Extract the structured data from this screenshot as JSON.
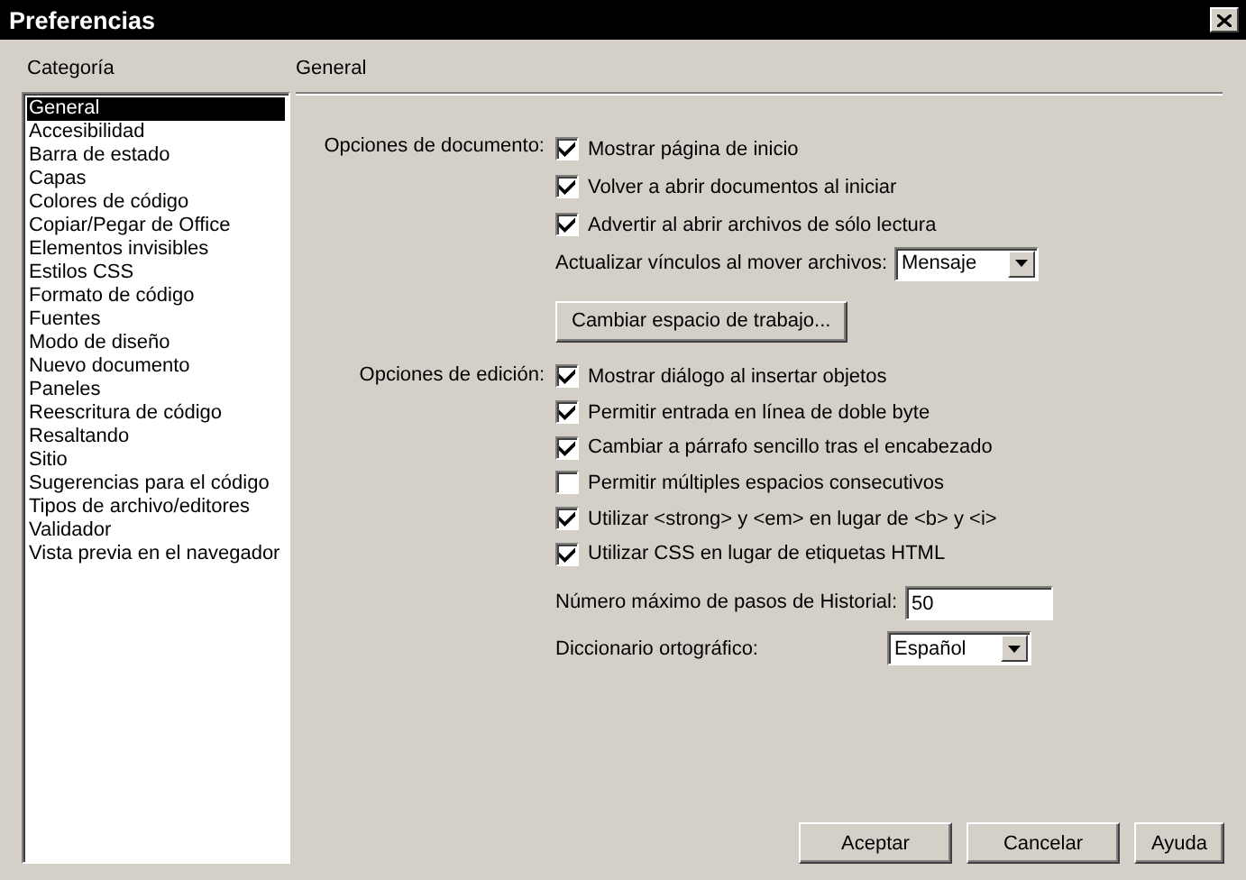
{
  "window": {
    "title": "Preferencias"
  },
  "category": {
    "heading": "Categoría",
    "items": [
      {
        "label": "General",
        "selected": true
      },
      {
        "label": "Accesibilidad",
        "selected": false
      },
      {
        "label": "Barra de estado",
        "selected": false
      },
      {
        "label": "Capas",
        "selected": false
      },
      {
        "label": "Colores de código",
        "selected": false
      },
      {
        "label": "Copiar/Pegar de Office",
        "selected": false
      },
      {
        "label": "Elementos invisibles",
        "selected": false
      },
      {
        "label": "Estilos CSS",
        "selected": false
      },
      {
        "label": "Formato de código",
        "selected": false
      },
      {
        "label": "Fuentes",
        "selected": false
      },
      {
        "label": "Modo de diseño",
        "selected": false
      },
      {
        "label": "Nuevo documento",
        "selected": false
      },
      {
        "label": "Paneles",
        "selected": false
      },
      {
        "label": "Reescritura de código",
        "selected": false
      },
      {
        "label": "Resaltando",
        "selected": false
      },
      {
        "label": "Sitio",
        "selected": false
      },
      {
        "label": "Sugerencias para el código",
        "selected": false
      },
      {
        "label": "Tipos de archivo/editores",
        "selected": false
      },
      {
        "label": "Validador",
        "selected": false
      },
      {
        "label": "Vista previa en el navegador",
        "selected": false
      }
    ]
  },
  "panel": {
    "heading": "General",
    "sections": [
      {
        "label": "Opciones de documento:",
        "items": [
          {
            "kind": "checkbox",
            "label": "Mostrar página de inicio",
            "checked": true
          },
          {
            "kind": "checkbox",
            "label": "Volver a abrir documentos al iniciar",
            "checked": true
          },
          {
            "kind": "checkbox",
            "label": "Advertir al abrir archivos de sólo lectura",
            "checked": true
          },
          {
            "kind": "select",
            "label": "Actualizar vínculos al mover archivos:",
            "value": "Mensaje"
          },
          {
            "kind": "button",
            "label": "Cambiar espacio de trabajo..."
          }
        ]
      },
      {
        "label": "Opciones de edición:",
        "items": [
          {
            "kind": "checkbox",
            "label": "Mostrar diálogo al insertar objetos",
            "checked": true
          },
          {
            "kind": "checkbox",
            "label": "Permitir entrada en línea de doble byte",
            "checked": true
          },
          {
            "kind": "checkbox",
            "label": "Cambiar a párrafo sencillo tras el encabezado",
            "checked": true
          },
          {
            "kind": "checkbox",
            "label": "Permitir múltiples espacios consecutivos",
            "checked": false
          },
          {
            "kind": "checkbox",
            "label": "Utilizar <strong> y <em> en lugar de <b> y <i>",
            "checked": true
          },
          {
            "kind": "checkbox",
            "label": "Utilizar CSS en lugar de etiquetas HTML",
            "checked": true
          },
          {
            "kind": "input",
            "label": "Número máximo de pasos de Historial:",
            "value": "50"
          },
          {
            "kind": "select",
            "label": "Diccionario ortográfico:",
            "value": "Español"
          }
        ]
      }
    ]
  },
  "buttons": [
    "Aceptar",
    "Cancelar",
    "Ayuda"
  ]
}
